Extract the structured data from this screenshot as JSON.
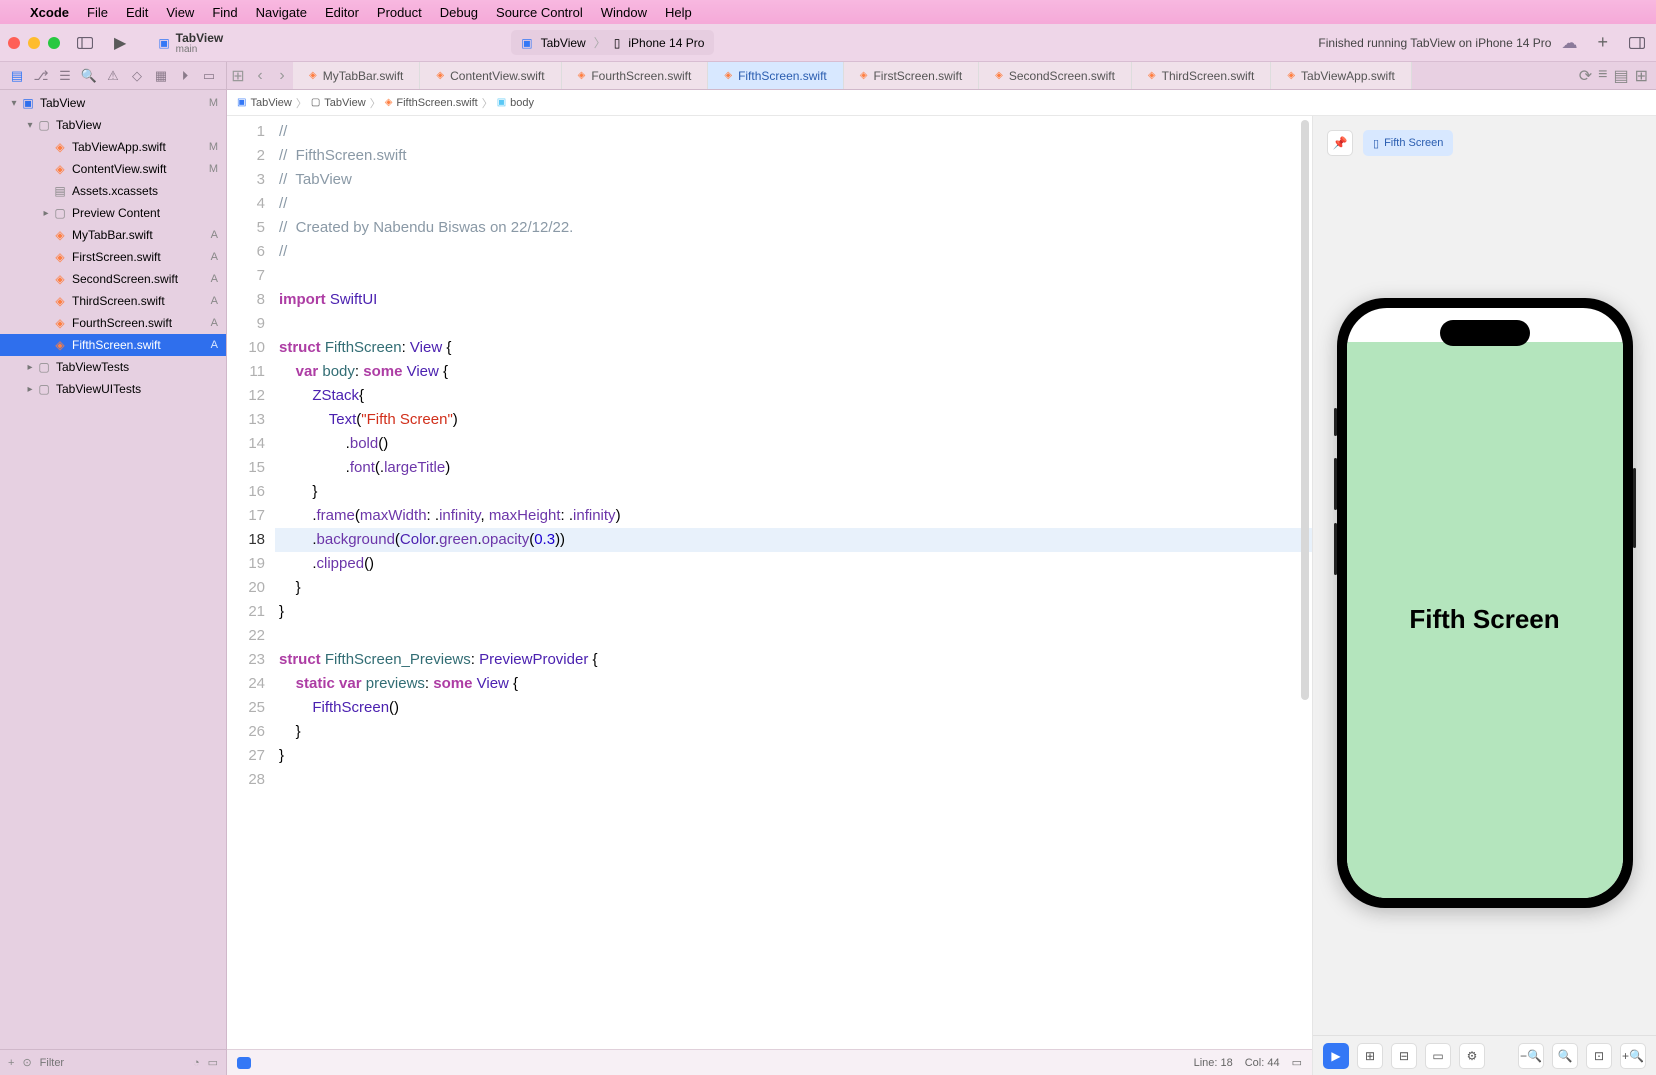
{
  "menubar": {
    "app": "Xcode",
    "items": [
      "File",
      "Edit",
      "View",
      "Find",
      "Navigate",
      "Editor",
      "Product",
      "Debug",
      "Source Control",
      "Window",
      "Help"
    ]
  },
  "toolbar": {
    "project": "TabView",
    "branch": "main",
    "scheme_target": "TabView",
    "device": "iPhone 14 Pro",
    "status": "Finished running TabView on iPhone 14 Pro"
  },
  "tabs": [
    {
      "label": "MyTabBar.swift",
      "active": false
    },
    {
      "label": "ContentView.swift",
      "active": false
    },
    {
      "label": "FourthScreen.swift",
      "active": false
    },
    {
      "label": "FifthScreen.swift",
      "active": true
    },
    {
      "label": "FirstScreen.swift",
      "active": false
    },
    {
      "label": "SecondScreen.swift",
      "active": false
    },
    {
      "label": "ThirdScreen.swift",
      "active": false
    },
    {
      "label": "TabViewApp.swift",
      "active": false
    }
  ],
  "tree": [
    {
      "indent": 0,
      "icon": "app",
      "label": "TabView",
      "badge": "M",
      "disc": "▾"
    },
    {
      "indent": 1,
      "icon": "folder",
      "label": "TabView",
      "badge": "",
      "disc": "▾"
    },
    {
      "indent": 2,
      "icon": "swift",
      "label": "TabViewApp.swift",
      "badge": "M",
      "disc": ""
    },
    {
      "indent": 2,
      "icon": "swift",
      "label": "ContentView.swift",
      "badge": "M",
      "disc": ""
    },
    {
      "indent": 2,
      "icon": "assets",
      "label": "Assets.xcassets",
      "badge": "",
      "disc": ""
    },
    {
      "indent": 2,
      "icon": "folder",
      "label": "Preview Content",
      "badge": "",
      "disc": "▸"
    },
    {
      "indent": 2,
      "icon": "swift",
      "label": "MyTabBar.swift",
      "badge": "A",
      "disc": ""
    },
    {
      "indent": 2,
      "icon": "swift",
      "label": "FirstScreen.swift",
      "badge": "A",
      "disc": ""
    },
    {
      "indent": 2,
      "icon": "swift",
      "label": "SecondScreen.swift",
      "badge": "A",
      "disc": ""
    },
    {
      "indent": 2,
      "icon": "swift",
      "label": "ThirdScreen.swift",
      "badge": "A",
      "disc": ""
    },
    {
      "indent": 2,
      "icon": "swift",
      "label": "FourthScreen.swift",
      "badge": "A",
      "disc": ""
    },
    {
      "indent": 2,
      "icon": "swift",
      "label": "FifthScreen.swift",
      "badge": "A",
      "disc": "",
      "selected": true
    },
    {
      "indent": 1,
      "icon": "folder",
      "label": "TabViewTests",
      "badge": "",
      "disc": "▸"
    },
    {
      "indent": 1,
      "icon": "folder",
      "label": "TabViewUITests",
      "badge": "",
      "disc": "▸"
    }
  ],
  "filter_placeholder": "Filter",
  "breadcrumb": [
    "TabView",
    "TabView",
    "FifthScreen.swift",
    "body"
  ],
  "code": {
    "highlight_line": 18,
    "total_lines": 28
  },
  "preview": {
    "chip": "Fifth Screen",
    "screen_text": "Fifth Screen"
  },
  "statusbar": {
    "line": "Line: 18",
    "col": "Col: 44"
  }
}
